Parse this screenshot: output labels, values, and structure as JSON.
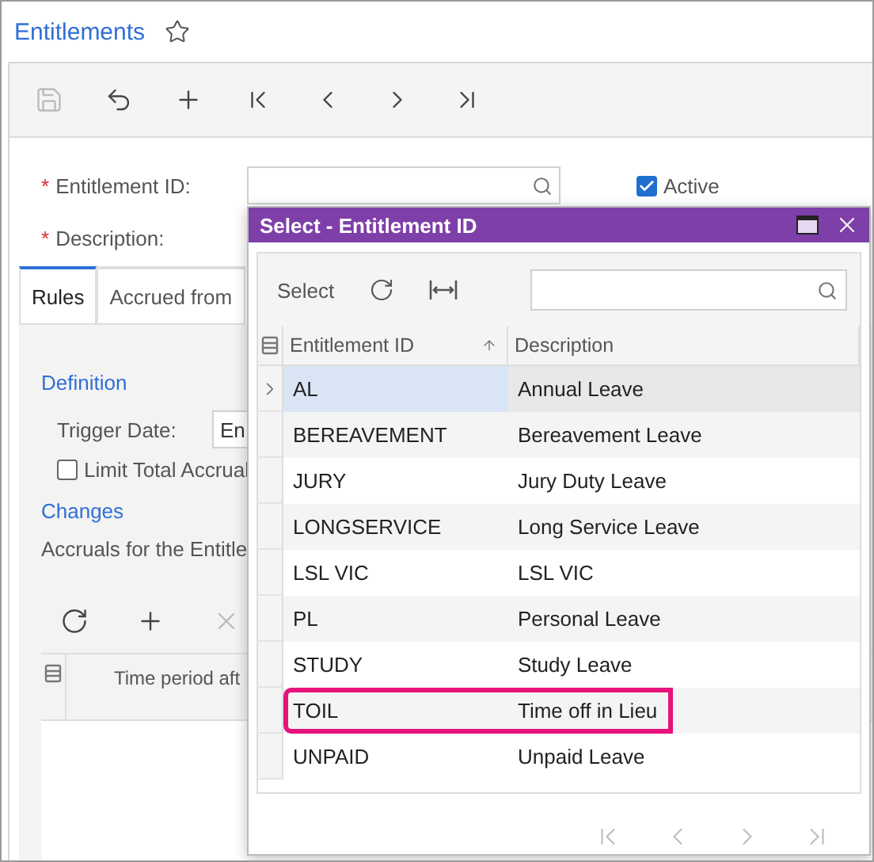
{
  "page": {
    "title": "Entitlements",
    "favorite": false
  },
  "toolbar": [
    {
      "kind": "save",
      "disabled": true
    },
    {
      "kind": "undo",
      "disabled": false
    },
    {
      "kind": "add",
      "disabled": false
    },
    {
      "kind": "first",
      "disabled": false
    },
    {
      "kind": "previous",
      "disabled": false
    },
    {
      "kind": "next",
      "disabled": false
    },
    {
      "kind": "last",
      "disabled": false
    }
  ],
  "form": {
    "entitlement_id": {
      "label": "Entitlement ID:",
      "required": true,
      "required_mark": "*"
    },
    "active": {
      "label": "Active",
      "checked": true
    },
    "description": {
      "label": "Description:",
      "required": true,
      "required_mark": "*"
    }
  },
  "tabs": [
    {
      "label": "Rules",
      "selected": true
    },
    {
      "label": "Accrued from",
      "selected": false
    }
  ],
  "rules": {
    "definition_heading": "Definition",
    "trigger_date": {
      "label": "Trigger Date:",
      "value": "En"
    },
    "limit_total_accrual": {
      "label": "Limit Total Accrual",
      "checked": false
    },
    "changes_heading": "Changes",
    "accruals_caption": "Accruals for the Entitle",
    "grid_toolbar": [
      {
        "kind": "refresh",
        "disabled": false
      },
      {
        "kind": "add",
        "disabled": false
      },
      {
        "kind": "delete",
        "disabled": true
      }
    ],
    "columns": [
      "Time period aft"
    ]
  },
  "dialog": {
    "title": "Select - Entitlement ID",
    "select_button": "Select",
    "columns": [
      {
        "label": "Entitlement ID",
        "sorted": true
      },
      {
        "label": "Description"
      }
    ],
    "rows": [
      {
        "id": "AL",
        "description": "Annual Leave",
        "selected": true,
        "highlighted": false
      },
      {
        "id": "BEREAVEMENT",
        "description": "Bereavement Leave",
        "selected": false,
        "highlighted": false
      },
      {
        "id": "JURY",
        "description": "Jury Duty Leave",
        "selected": false,
        "highlighted": false
      },
      {
        "id": "LONGSERVICE",
        "description": "Long Service Leave",
        "selected": false,
        "highlighted": false
      },
      {
        "id": "LSL VIC",
        "description": "LSL VIC",
        "selected": false,
        "highlighted": false
      },
      {
        "id": "PL",
        "description": "Personal Leave",
        "selected": false,
        "highlighted": false
      },
      {
        "id": "STUDY",
        "description": "Study Leave",
        "selected": false,
        "highlighted": false
      },
      {
        "id": "TOIL",
        "description": "Time off in Lieu",
        "selected": false,
        "highlighted": true
      },
      {
        "id": "UNPAID",
        "description": "Unpaid Leave",
        "selected": false,
        "highlighted": false
      }
    ],
    "pager": [
      {
        "kind": "first",
        "disabled": true
      },
      {
        "kind": "previous",
        "disabled": true
      },
      {
        "kind": "next",
        "disabled": true
      },
      {
        "kind": "last",
        "disabled": true
      }
    ]
  }
}
